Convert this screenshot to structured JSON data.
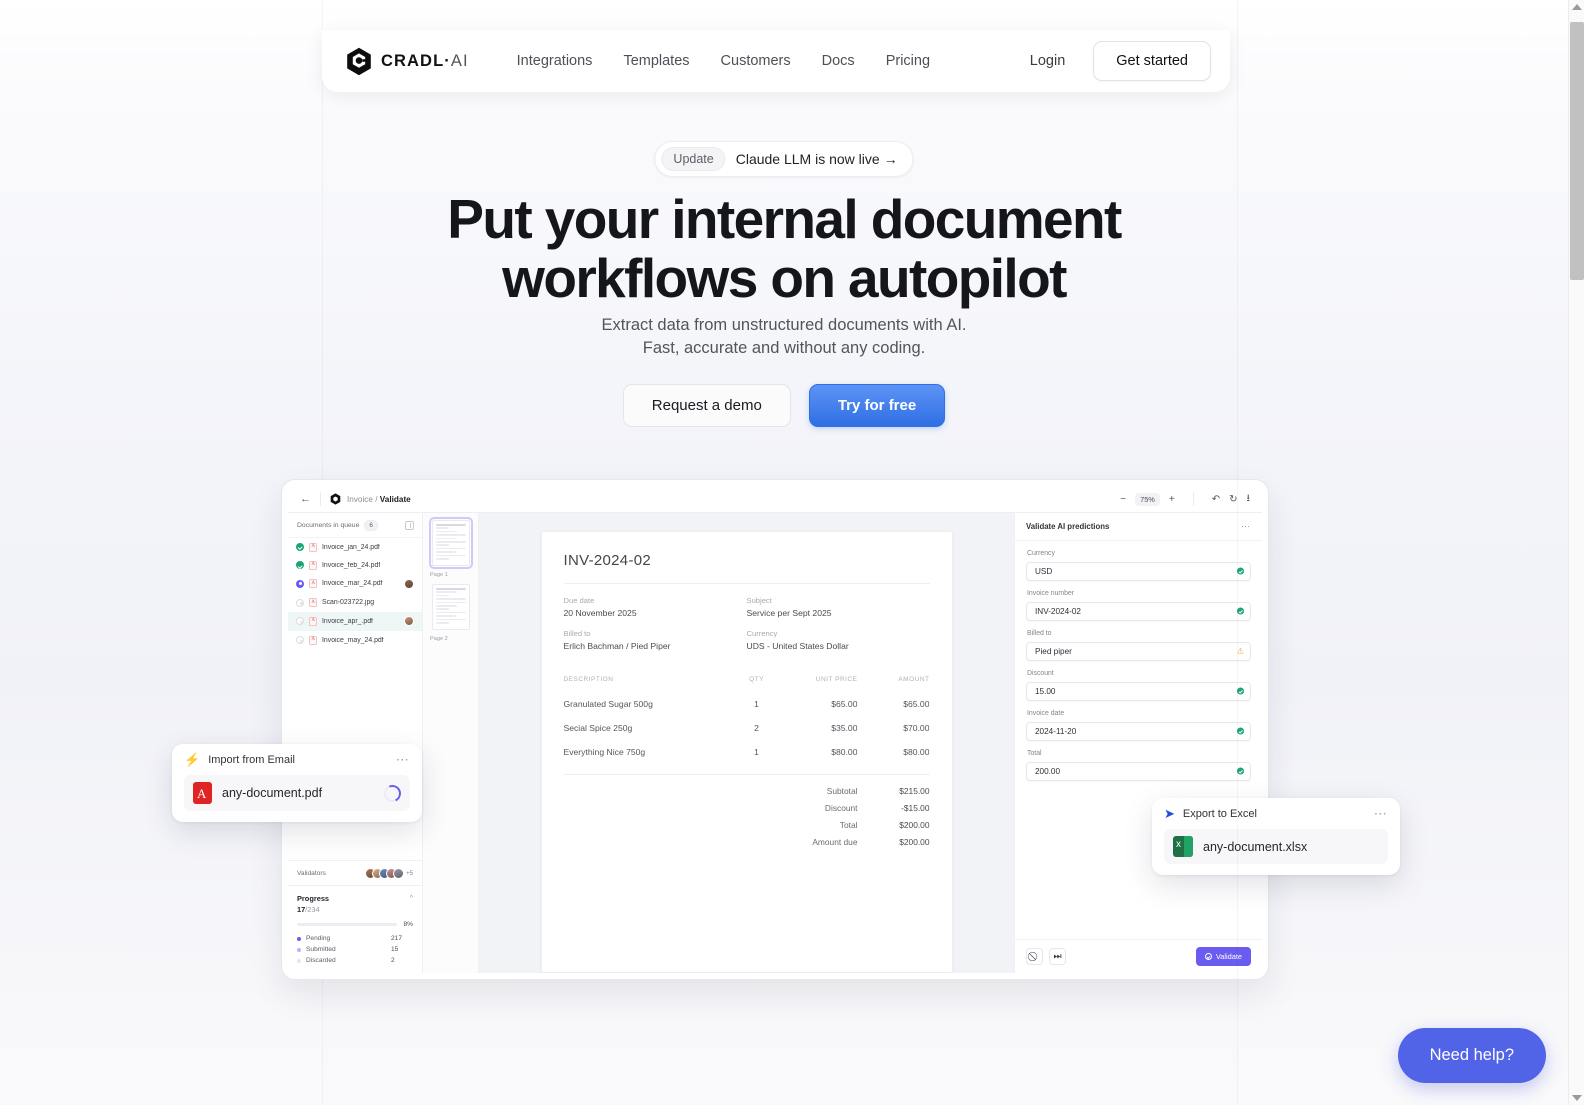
{
  "nav": {
    "brand": "CRADL",
    "brand_suffix": "AI",
    "brand_dot": "·",
    "logo_icon": "cradl-hexagon-logo",
    "links": [
      {
        "label": "Integrations"
      },
      {
        "label": "Templates"
      },
      {
        "label": "Customers"
      },
      {
        "label": "Docs"
      },
      {
        "label": "Pricing"
      }
    ],
    "login_label": "Login",
    "get_started_label": "Get started"
  },
  "hero": {
    "update_tag": "Update",
    "update_message": "Claude LLM is now live →",
    "headline_line1": "Put your internal document",
    "headline_line2": "workflows on autopilot",
    "subhead_line1": "Extract data from unstructured documents with AI.",
    "subhead_line2": "Fast, accurate and without any coding.",
    "cta_secondary": "Request a demo",
    "cta_primary": "Try for free"
  },
  "app": {
    "topbar": {
      "back_icon": "back-arrow-icon",
      "logo_icon": "cradl-mark-icon",
      "breadcrumb_root": "Invoice",
      "breadcrumb_sep": " / ",
      "breadcrumb_current": "Validate",
      "zoom_out_icon": "minus-icon",
      "zoom_level": "75%",
      "zoom_in_icon": "plus-icon",
      "undo_icon": "rotate-ccw-icon",
      "redo_icon": "rotate-cw-icon",
      "download_icon": "download-icon"
    },
    "queue": {
      "title": "Documents in queue",
      "count": "6",
      "panel_toggle_icon": "panel-toggle-icon",
      "items": [
        {
          "name": "Invoice_jan_24.pdf",
          "status": "done",
          "avatar": false,
          "selected": false
        },
        {
          "name": "Invoice_feb_24.pdf",
          "status": "done",
          "avatar": false,
          "selected": false
        },
        {
          "name": "Invoice_mar_24.pdf",
          "status": "active",
          "avatar": true,
          "selected": false
        },
        {
          "name": "Scan-023722.jpg",
          "status": "idle",
          "avatar": false,
          "selected": false
        },
        {
          "name": "Invoice_apr_.pdf",
          "status": "idle",
          "avatar": true,
          "selected": true
        },
        {
          "name": "Invoice_may_24.pdf",
          "status": "idle",
          "avatar": false,
          "selected": false
        }
      ]
    },
    "validators": {
      "label": "Validators",
      "more_count": "+5"
    },
    "progress": {
      "title": "Progress",
      "collapse_icon": "chevron-up-icon",
      "done": "17",
      "total": "/234",
      "percent_label": "8%",
      "percent_value": 8,
      "legend": [
        {
          "label": "Pending",
          "value": "217"
        },
        {
          "label": "Submitted",
          "value": "15"
        },
        {
          "label": "Discarded",
          "value": "2"
        }
      ]
    },
    "thumbnails": [
      {
        "label": "Page 1",
        "selected": true
      },
      {
        "label": "Page 2",
        "selected": false
      }
    ],
    "document": {
      "title": "INV-2024-02",
      "fields": [
        {
          "key": "Due date",
          "value": "20 November 2025"
        },
        {
          "key": "Subject",
          "value": "Service per Sept 2025"
        },
        {
          "key": "Billed to",
          "value": "Erlich Bachman / Pied Piper"
        },
        {
          "key": "Currency",
          "value": "UDS - United States Dollar"
        }
      ],
      "table_headers": [
        "DESCRIPTION",
        "QTY",
        "UNIT PRICE",
        "AMOUNT"
      ],
      "table_rows": [
        [
          "Granulated Sugar 500g",
          "1",
          "$65.00",
          "$65.00"
        ],
        [
          "Secial Spice 250g",
          "2",
          "$35.00",
          "$70.00"
        ],
        [
          "Everything Nice 750g",
          "1",
          "$80.00",
          "$80.00"
        ]
      ],
      "totals": [
        {
          "label": "Subtotal",
          "value": "$215.00"
        },
        {
          "label": "Discount",
          "value": "-$15.00"
        },
        {
          "label": "Total",
          "value": "$200.00"
        },
        {
          "label": "Amount due",
          "value": "$200.00"
        }
      ]
    },
    "validate_panel": {
      "title": "Validate AI predictions",
      "menu_icon": "more-horizontal-icon",
      "fields": [
        {
          "key": "Currency",
          "value": "USD",
          "state": "ok"
        },
        {
          "key": "Invoice number",
          "value": "INV-2024-02",
          "state": "ok"
        },
        {
          "key": "Billed to",
          "value": "Pied piper",
          "state": "warn"
        },
        {
          "key": "Discount",
          "value": "15.00",
          "state": "ok"
        },
        {
          "key": "Invoice date",
          "value": "2024-11-20",
          "state": "ok"
        },
        {
          "key": "Total",
          "value": "200.00",
          "state": "ok"
        }
      ],
      "reject_icon": "no-entry-icon",
      "skip_icon": "skip-forward-icon",
      "validate_label": "Validate",
      "validate_icon": "check-circle-icon"
    }
  },
  "import_card": {
    "icon": "lightning-bolt-icon",
    "title": "Import from Email",
    "menu_icon": "more-horizontal-icon",
    "file_icon": "pdf-file-icon",
    "file_name": "any-document.pdf",
    "spinner_icon": "loading-spinner-icon"
  },
  "export_card": {
    "icon": "send-plane-icon",
    "title": "Export to Excel",
    "menu_icon": "more-horizontal-icon",
    "file_icon": "excel-file-icon",
    "file_name": "any-document.xlsx"
  },
  "need_help": {
    "label": "Need help?"
  },
  "colors": {
    "primary_blue": "#2f6fe4",
    "brand_purple": "#6b5cf0",
    "success_green": "#17a673",
    "warn_amber": "#e9a23b",
    "help_blue": "#5164e8"
  }
}
